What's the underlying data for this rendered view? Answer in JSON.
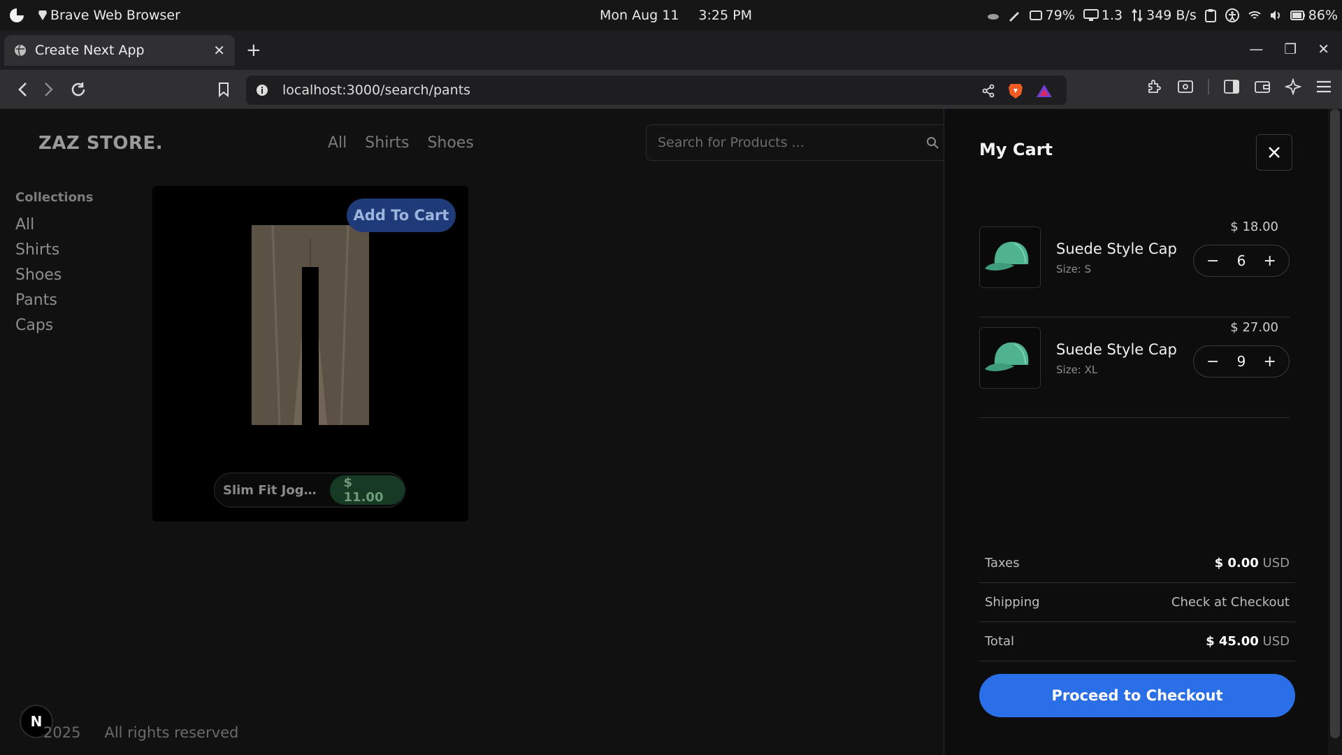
{
  "os_bar": {
    "app_name": "Brave Web Browser",
    "date": "Mon Aug 11",
    "time": "3:25 PM",
    "cpu": "79%",
    "display": "1.3",
    "net": "349 B/s",
    "battery": "86%"
  },
  "browser": {
    "tab_title": "Create Next App",
    "url": "localhost:3000/search/pants"
  },
  "store": {
    "logo": "ZAZ STORE.",
    "nav": [
      "All",
      "Shirts",
      "Shoes"
    ],
    "search_placeholder": "Search for Products ...",
    "collections_title": "Collections",
    "collections": [
      "All",
      "Shirts",
      "Shoes",
      "Pants",
      "Caps"
    ],
    "product": {
      "add_to_cart": "Add To Cart",
      "name": "Slim Fit Jogge...",
      "price": "$ 11.00"
    },
    "footer": {
      "year": "2025",
      "rights": "All rights reserved",
      "badge": "N"
    }
  },
  "cart": {
    "title": "My Cart",
    "items": [
      {
        "name": "Suede Style Cap",
        "size": "Size: S",
        "price": "$ 18.00",
        "qty": "6"
      },
      {
        "name": "Suede Style Cap",
        "size": "Size: XL",
        "price": "$ 27.00",
        "qty": "9"
      }
    ],
    "summary": {
      "taxes_label": "Taxes",
      "taxes_value": "$ 0.00",
      "taxes_currency": "USD",
      "shipping_label": "Shipping",
      "shipping_value": "Check at Checkout",
      "total_label": "Total",
      "total_value": "$ 45.00",
      "total_currency": "USD"
    },
    "checkout_label": "Proceed to Checkout"
  },
  "colors": {
    "accent": "#2a6fe8",
    "cap": "#4fb38f"
  }
}
